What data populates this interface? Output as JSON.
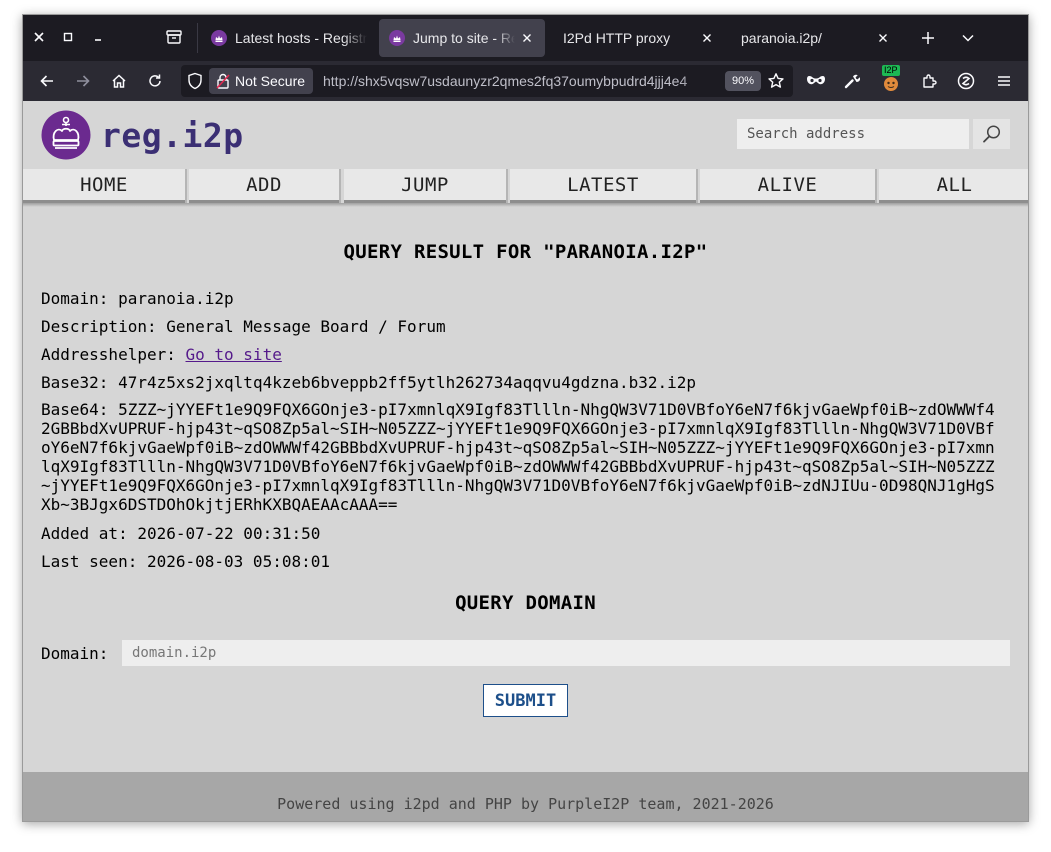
{
  "browser": {
    "tabs": [
      {
        "label": "Latest hosts - Registry"
      },
      {
        "label": "Jump to site - Registry",
        "active": true
      },
      {
        "label": "I2Pd HTTP proxy"
      },
      {
        "label": "paranoia.i2p/"
      }
    ],
    "security_label": "Not Secure",
    "url": "http://shx5vqsw7usdaunyzr2qmes2fq37oumybpudrd4jjj4e4",
    "zoom": "90%",
    "extension_badge": "I2P"
  },
  "site": {
    "logo_text": "reg.i2p",
    "search_placeholder": "Search address",
    "menu": [
      "HOME",
      "ADD",
      "JUMP",
      "LATEST",
      "ALIVE",
      "ALL"
    ]
  },
  "result": {
    "title": "QUERY RESULT FOR \"PARANOIA.I2P\"",
    "domain_label": "Domain:",
    "domain_value": "paranoia.i2p",
    "description_label": "Description:",
    "description_value": "General Message Board / Forum",
    "addresshelper_label": "Addresshelper:",
    "addresshelper_link": "Go to site",
    "base32_label": "Base32:",
    "base32_value": "47r4z5xs2jxqltq4kzeb6bveppb2ff5ytlh262734aqqvu4gdzna.b32.i2p",
    "base64_label": "Base64:",
    "base64_value": "5ZZZ~jYYEFt1e9Q9FQX6GOnje3-pI7xmnlqX9Igf83Tllln-NhgQW3V71D0VBfoY6eN7f6kjvGaeWpf0iB~zdOWWWf42GBBbdXvUPRUF-hjp43t~qSO8Zp5al~SIH~N05ZZZ~jYYEFt1e9Q9FQX6GOnje3-pI7xmnlqX9Igf83Tllln-NhgQW3V71D0VBfoY6eN7f6kjvGaeWpf0iB~zdOWWWf42GBBbdXvUPRUF-hjp43t~qSO8Zp5al~SIH~N05ZZZ~jYYEFt1e9Q9FQX6GOnje3-pI7xmnlqX9Igf83Tllln-NhgQW3V71D0VBfoY6eN7f6kjvGaeWpf0iB~zdOWWWf42GBBbdXvUPRUF-hjp43t~qSO8Zp5al~SIH~N05ZZZ~jYYEFt1e9Q9FQX6GOnje3-pI7xmnlqX9Igf83Tllln-NhgQW3V71D0VBfoY6eN7f6kjvGaeWpf0iB~zdNJIUu-0D98QNJ1gHgSXb~3BJgx6DSTDOhOkjtjERhKXBQAEAAcAAA==",
    "added_label": "Added at:",
    "added_value": "2026-07-22 00:31:50",
    "lastseen_label": "Last seen:",
    "lastseen_value": "2026-08-03 05:08:01"
  },
  "query": {
    "title": "QUERY DOMAIN",
    "domain_label": "Domain:",
    "domain_placeholder": "domain.i2p",
    "submit_label": "SUBMIT"
  },
  "footer": {
    "text": "Powered using i2pd and PHP by PurpleI2P team, 2021-2026"
  },
  "colors": {
    "logo_purple": "#6b2a8f",
    "logo_text": "#3b2f74",
    "link": "#551a8b",
    "submit_border": "#1d4f8a",
    "page_bg": "#d6d6d6",
    "footer_bg": "#a7a7a7"
  }
}
